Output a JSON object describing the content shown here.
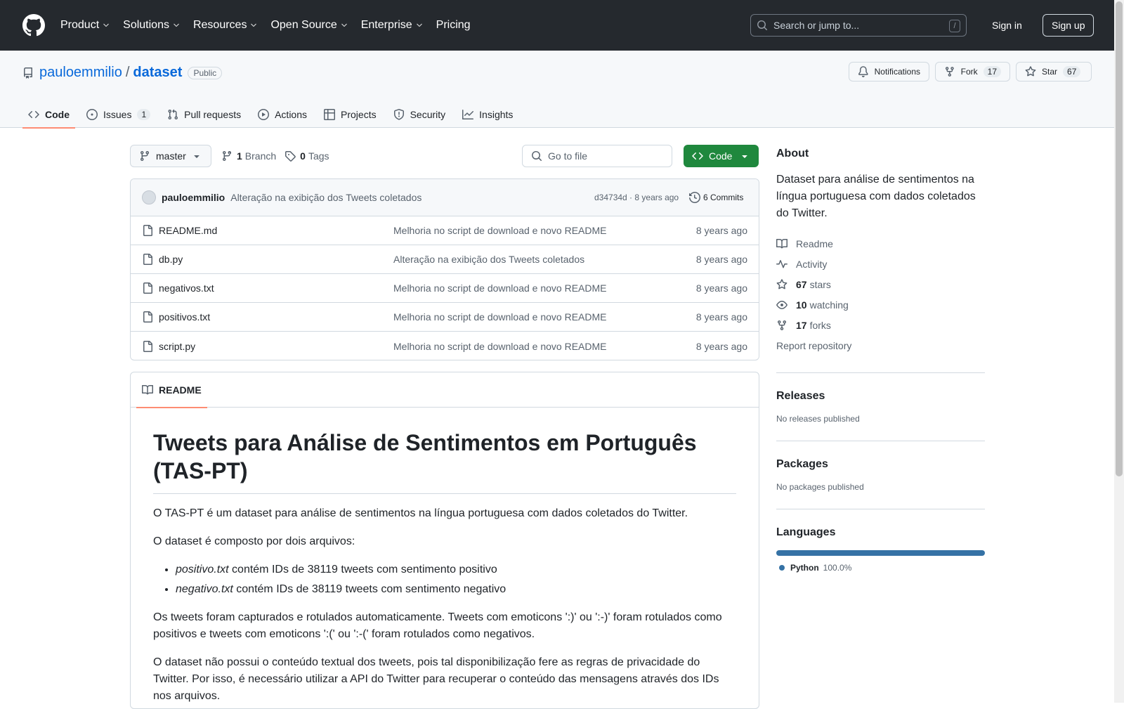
{
  "header": {
    "nav": [
      "Product",
      "Solutions",
      "Resources",
      "Open Source",
      "Enterprise",
      "Pricing"
    ],
    "search_placeholder": "Search or jump to...",
    "search_shortcut": "/",
    "signin": "Sign in",
    "signup": "Sign up"
  },
  "repo": {
    "owner": "pauloemmilio",
    "sep": "/",
    "name": "dataset",
    "visibility": "Public",
    "notifications": "Notifications",
    "fork_label": "Fork",
    "fork_count": "17",
    "star_label": "Star",
    "star_count": "67"
  },
  "tabs": [
    {
      "label": "Code"
    },
    {
      "label": "Issues",
      "count": "1"
    },
    {
      "label": "Pull requests"
    },
    {
      "label": "Actions"
    },
    {
      "label": "Projects"
    },
    {
      "label": "Security"
    },
    {
      "label": "Insights"
    }
  ],
  "toolbar": {
    "branch": "master",
    "branch_count": "1",
    "branch_label": "Branch",
    "tag_count": "0",
    "tag_label": "Tags",
    "gofile_placeholder": "Go to file",
    "code_button": "Code"
  },
  "commit": {
    "author": "pauloemmilio",
    "message": "Alteração na exibição dos Tweets coletados",
    "hash_age": "d34734d · 8 years ago",
    "commits": "6 Commits"
  },
  "files": [
    {
      "name": "README.md",
      "msg": "Melhoria no script de download e novo README",
      "age": "8 years ago"
    },
    {
      "name": "db.py",
      "msg": "Alteração na exibição dos Tweets coletados",
      "age": "8 years ago"
    },
    {
      "name": "negativos.txt",
      "msg": "Melhoria no script de download e novo README",
      "age": "8 years ago"
    },
    {
      "name": "positivos.txt",
      "msg": "Melhoria no script de download e novo README",
      "age": "8 years ago"
    },
    {
      "name": "script.py",
      "msg": "Melhoria no script de download e novo README",
      "age": "8 years ago"
    }
  ],
  "readme": {
    "tab": "README",
    "title": "Tweets para Análise de Sentimentos em Português (TAS-PT)",
    "p1": "O TAS-PT é um dataset para análise de sentimentos na língua portuguesa com dados coletados do Twitter.",
    "p2": "O dataset é composto por dois arquivos:",
    "li1_file": "positivo.txt",
    "li1_text": " contém IDs de 38119 tweets com sentimento positivo",
    "li2_file": "negativo.txt",
    "li2_text": " contém IDs de 38119 tweets com sentimento negativo",
    "p3": "Os tweets foram capturados e rotulados automaticamente. Tweets com emoticons ':)' ou ':-)' foram rotulados como positivos e tweets com emoticons ':(' ou ':-(' foram rotulados como negativos.",
    "p4": "O dataset não possui o conteúdo textual dos tweets, pois tal disponibilização fere as regras de privacidade do Twitter. Por isso, é necessário utilizar a API do Twitter para recuperar o conteúdo das mensagens através dos IDs nos arquivos."
  },
  "sidebar": {
    "about_title": "About",
    "about": "Dataset para análise de sentimentos na língua portuguesa com dados coletados do Twitter.",
    "readme": "Readme",
    "activity": "Activity",
    "stars_count": "67",
    "stars": "stars",
    "watching_count": "10",
    "watching": "watching",
    "forks_count": "17",
    "forks": "forks",
    "report": "Report repository",
    "releases_title": "Releases",
    "releases": "No releases published",
    "packages_title": "Packages",
    "packages": "No packages published",
    "languages_title": "Languages",
    "lang_name": "Python",
    "lang_pct": "100.0%",
    "lang_color": "#3572A5"
  }
}
